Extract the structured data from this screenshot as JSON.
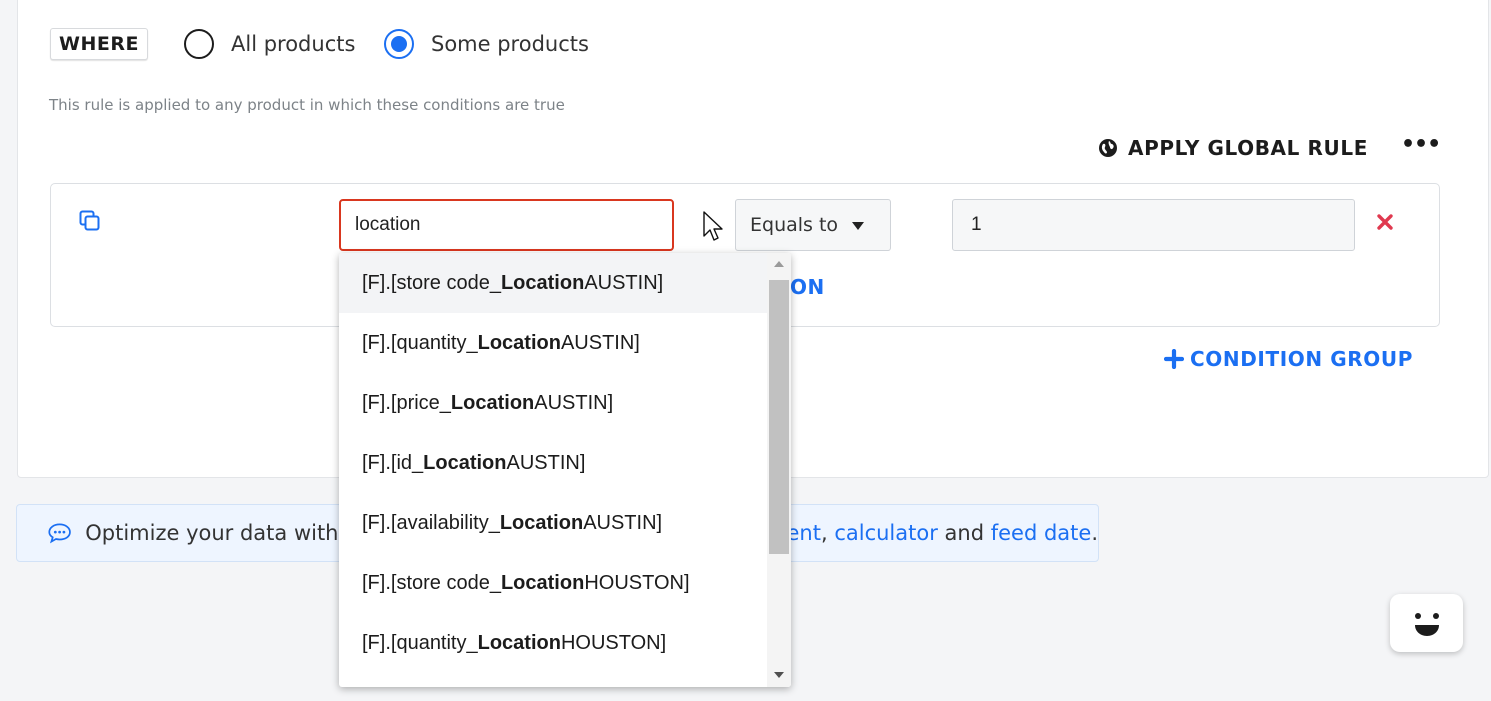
{
  "where": {
    "badge": "WHERE",
    "options": [
      {
        "label": "All products",
        "checked": false
      },
      {
        "label": "Some products",
        "checked": true
      }
    ],
    "description": "This rule is applied to any product in which these conditions are true"
  },
  "actions": {
    "apply_global_rule": "APPLY GLOBAL RULE",
    "more": "•••"
  },
  "condition": {
    "field_value": "location",
    "operator": "Equals to",
    "value": "1",
    "add_condition_partial": "ON"
  },
  "condition_group_label": "CONDITION GROUP",
  "dropdown": {
    "highlighted_index": 0,
    "options": [
      {
        "prefix": "[F].[store code_",
        "match": "Location",
        "suffix": "AUSTIN]"
      },
      {
        "prefix": "[F].[quantity_",
        "match": "Location",
        "suffix": "AUSTIN]"
      },
      {
        "prefix": "[F].[price_",
        "match": "Location",
        "suffix": "AUSTIN]"
      },
      {
        "prefix": "[F].[id_",
        "match": "Location",
        "suffix": "AUSTIN]"
      },
      {
        "prefix": "[F].[availability_",
        "match": "Location",
        "suffix": "AUSTIN]"
      },
      {
        "prefix": "[F].[store code_",
        "match": "Location",
        "suffix": "HOUSTON]"
      },
      {
        "prefix": "[F].[quantity_",
        "match": "Location",
        "suffix": "HOUSTON]"
      }
    ]
  },
  "tip": {
    "visible_start": "Optimize your data with",
    "visible_end_link1": "ent",
    "sep1": ", ",
    "link2": "calculator",
    "and": " and ",
    "link3": "feed date",
    "end": "."
  },
  "icons": {
    "copy": "copy-icon",
    "globe": "globe-icon",
    "remove": "close-icon",
    "plus": "plus-icon",
    "chat": "chat-icon",
    "assistant": "chatbot-face-icon"
  },
  "colors": {
    "accent": "#1b6ff2",
    "error_border": "#d9371f",
    "remove": "#e0394f"
  }
}
